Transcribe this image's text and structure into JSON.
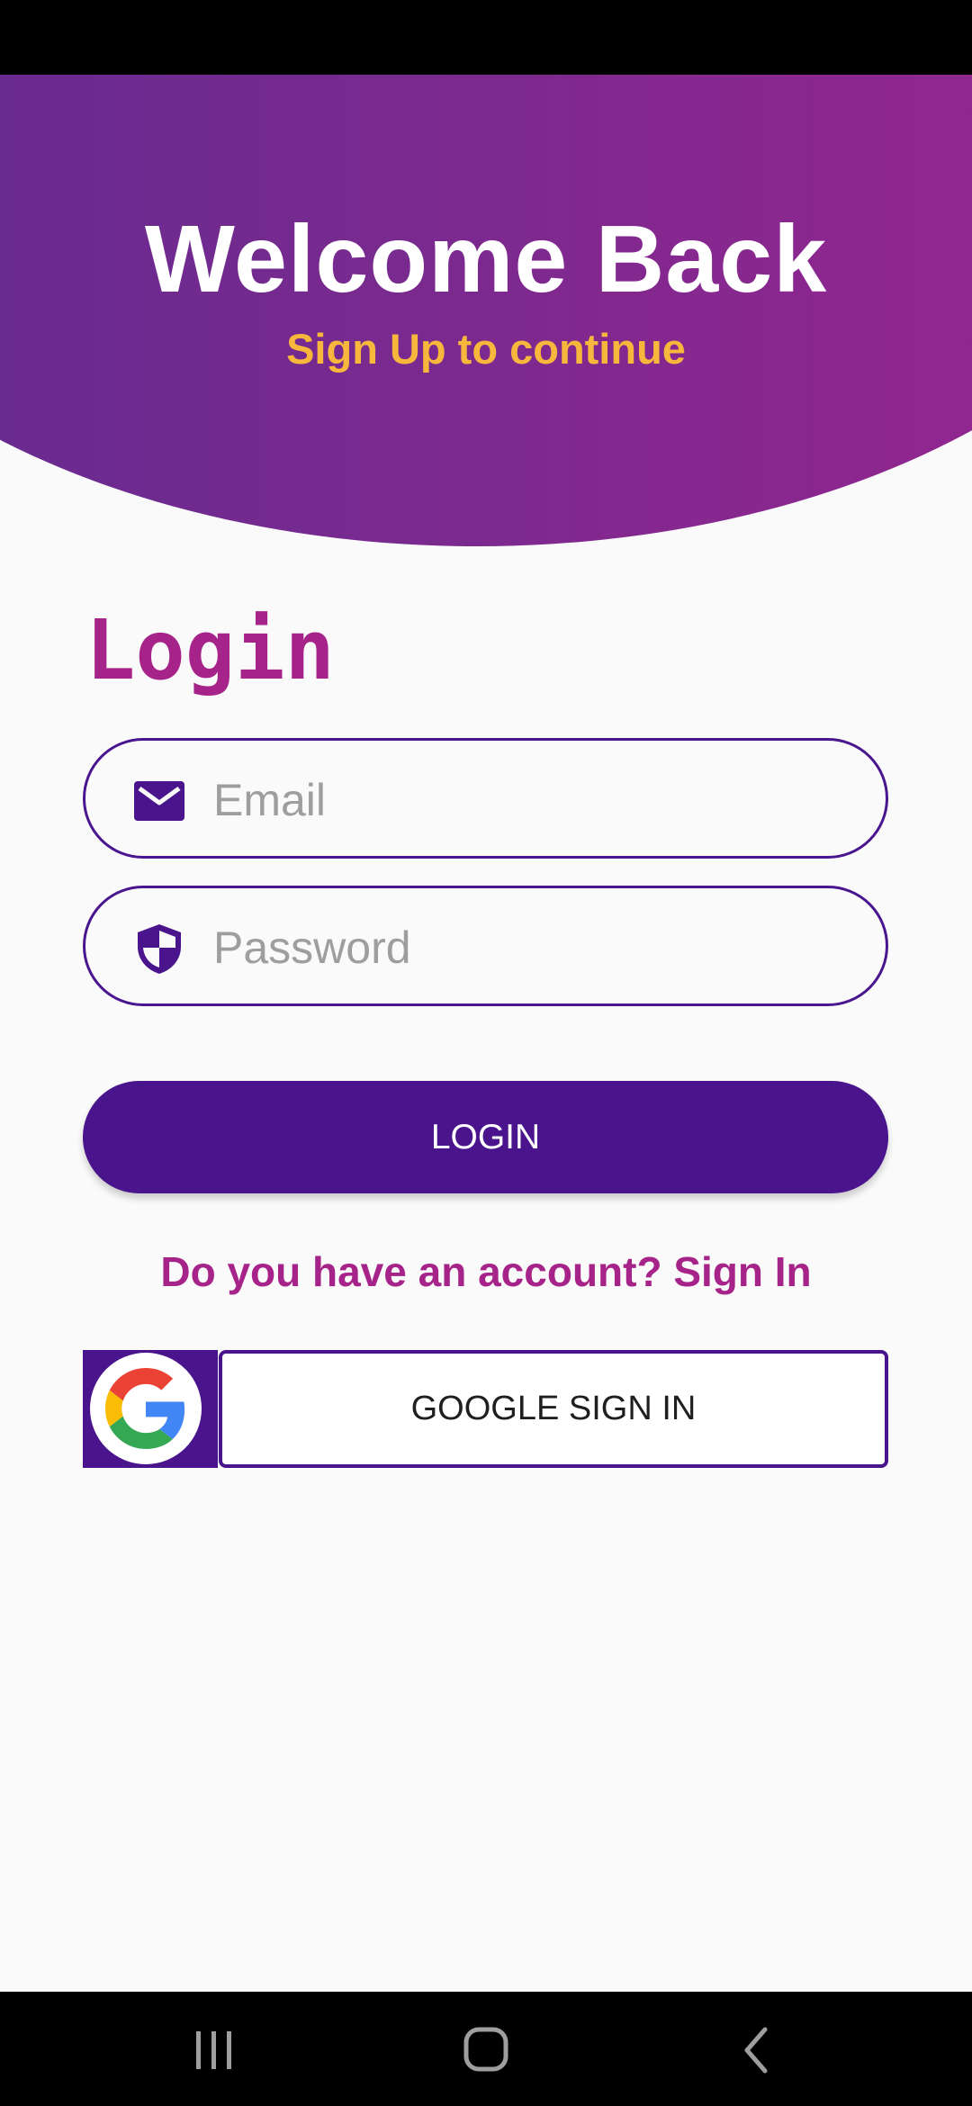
{
  "header": {
    "title": "Welcome Back",
    "subtitle": "Sign Up to continue"
  },
  "login": {
    "heading": "Login",
    "email_placeholder": "Email",
    "password_placeholder": "Password",
    "login_button": "LOGIN",
    "signin_prompt": "Do you have an account? Sign In",
    "google_button": "GOOGLE SIGN IN"
  },
  "icons": {
    "email": "mail-icon",
    "password": "shield-icon",
    "google": "google-logo-icon",
    "nav_recent": "recent-apps-icon",
    "nav_home": "home-icon",
    "nav_back": "back-icon"
  },
  "colors": {
    "header_gradient_start": "#5e2b91",
    "header_gradient_end": "#94268e",
    "subtitle": "#f6b73c",
    "accent_magenta": "#a6248a",
    "primary_purple": "#4a148c"
  }
}
